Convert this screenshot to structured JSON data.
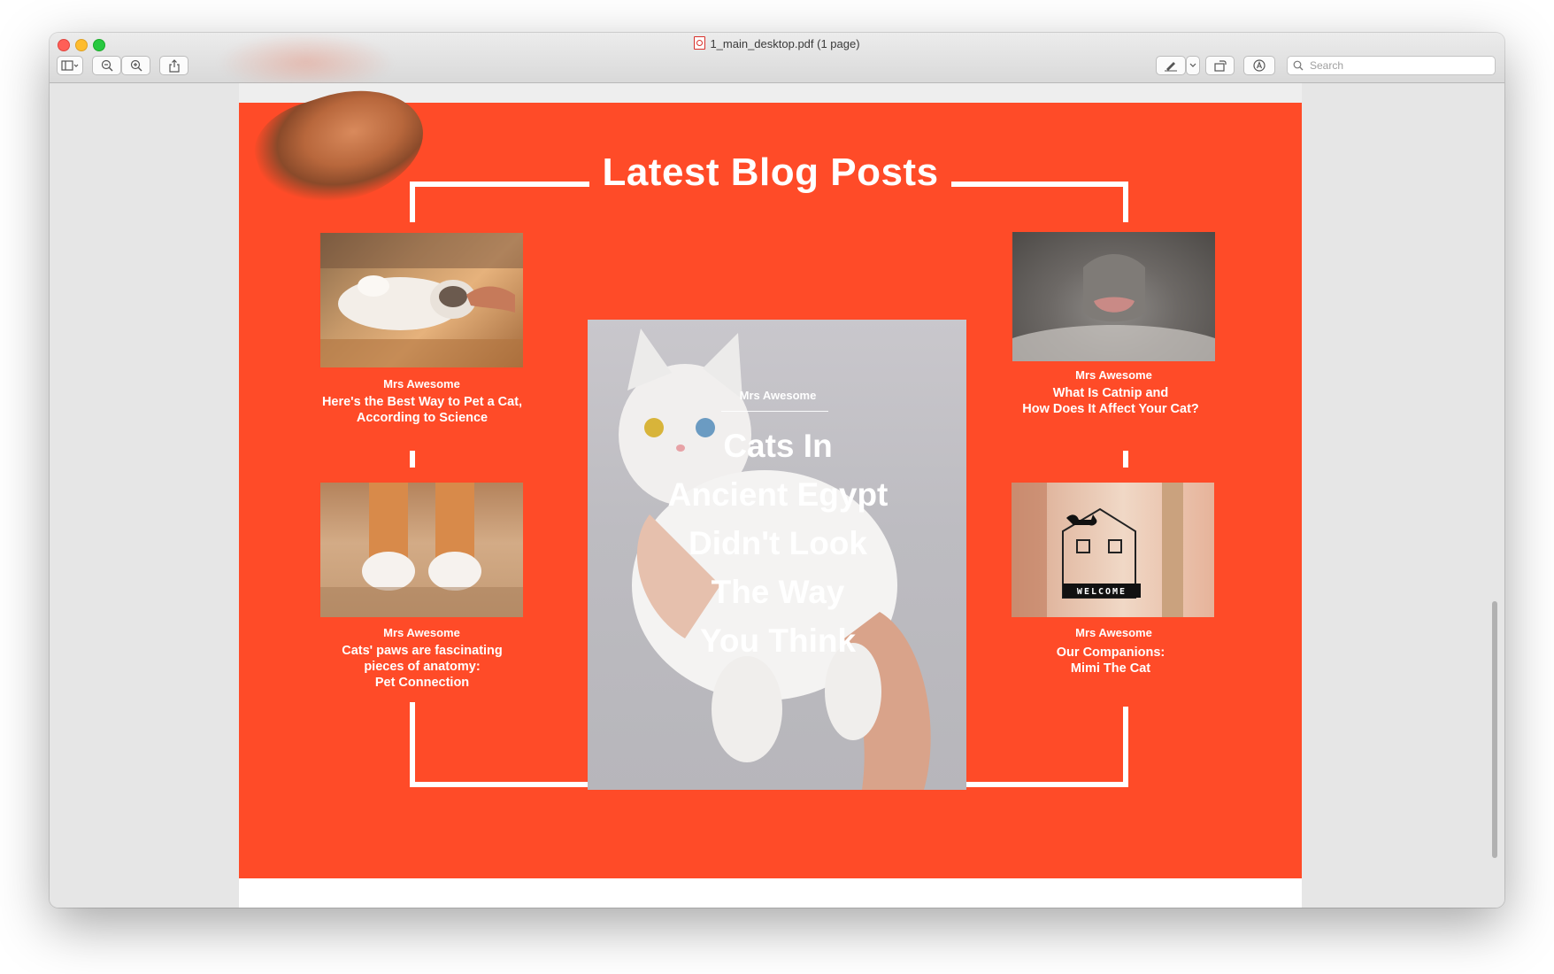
{
  "window": {
    "title": "1_main_desktop.pdf (1 page)",
    "search_placeholder": "Search"
  },
  "page": {
    "section_heading": "Latest Blog Posts",
    "colors": {
      "accent": "#ff4b28",
      "text": "#ffffff"
    },
    "posts_left": [
      {
        "author": "Mrs Awesome",
        "title_lines": [
          "Here's the Best Way to Pet a Cat,",
          "According to Science"
        ],
        "image": "cat-being-petted-photo"
      },
      {
        "author": "Mrs Awesome",
        "title_lines": [
          "Cats' paws are fascinating",
          "pieces of anatomy:",
          "Pet Connection"
        ],
        "image": "cat-paws-photo"
      }
    ],
    "featured": {
      "author": "Mrs Awesome",
      "title_lines": [
        "Cats In",
        "Ancient Egypt",
        "Didn't Look",
        "The Way",
        "You Think"
      ],
      "image": "white-cat-held-photo"
    },
    "posts_right": [
      {
        "author": "Mrs Awesome",
        "title_lines": [
          "What Is Catnip and",
          "How Does It Affect Your Cat?"
        ],
        "image": "cat-nose-closeup-photo"
      },
      {
        "author": "Mrs Awesome",
        "title_lines": [
          "Our Companions:",
          "Mimi The Cat"
        ],
        "image": "welcome-sign-cat-photo",
        "sign_text": "WELCOME"
      }
    ]
  }
}
